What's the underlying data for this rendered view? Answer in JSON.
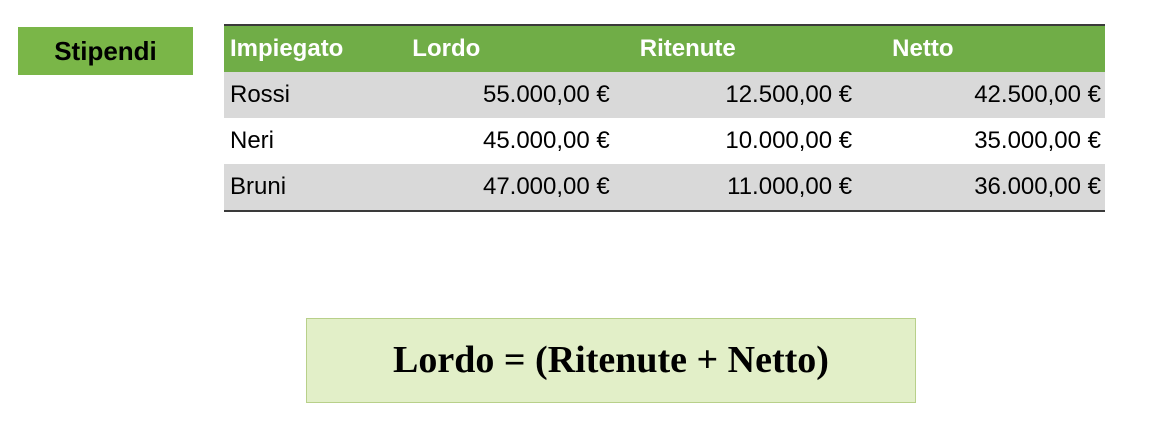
{
  "sheet_label": "Stipendi",
  "table": {
    "headers": [
      "Impiegato",
      "Lordo",
      "Ritenute",
      "Netto"
    ],
    "rows": [
      [
        "Rossi",
        "55.000,00 €",
        "12.500,00 €",
        "42.500,00 €"
      ],
      [
        "Neri",
        "45.000,00 €",
        "10.000,00 €",
        "35.000,00 €"
      ],
      [
        "Bruni",
        "47.000,00 €",
        "11.000,00 €",
        "36.000,00 €"
      ]
    ]
  },
  "formula": "Lordo = (Ritenute + Netto)",
  "colors": {
    "label_bg": "#7ab648",
    "header_bg": "#70ad47",
    "row_shade": "#d9d9d9",
    "formula_bg": "#e2efc8"
  }
}
